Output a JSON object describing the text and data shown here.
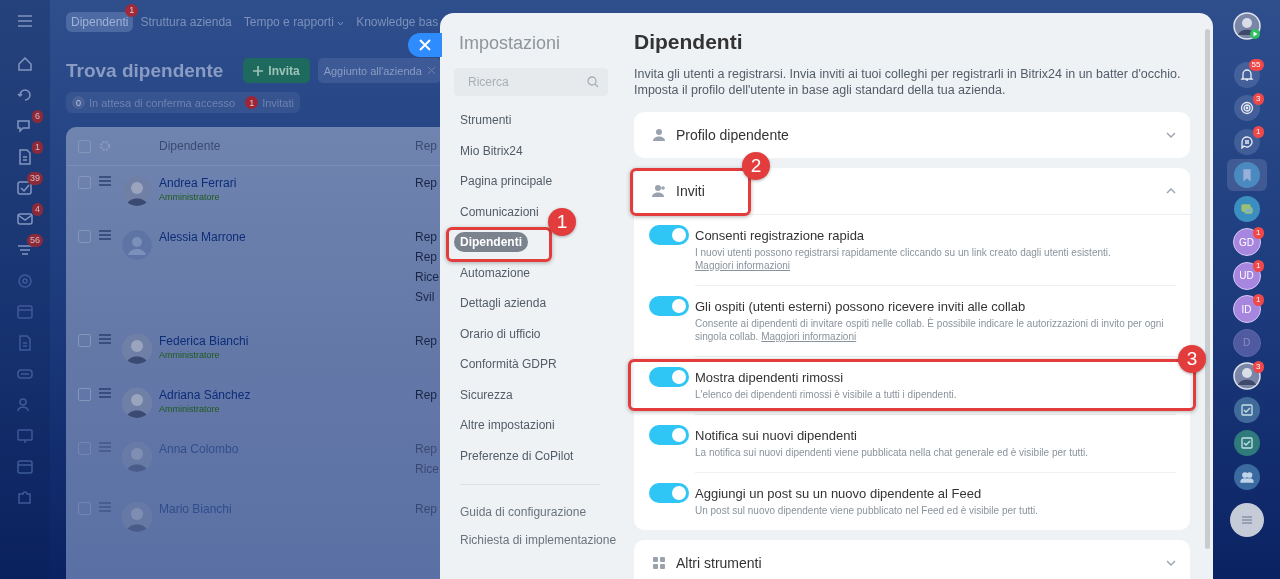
{
  "left_rail": [
    {
      "kind": "home"
    },
    {
      "kind": "refresh"
    },
    {
      "kind": "chat",
      "badge": "6"
    },
    {
      "kind": "doc",
      "badge": "1"
    },
    {
      "kind": "tasks",
      "badge": "39"
    },
    {
      "kind": "mail",
      "badge": "4"
    },
    {
      "kind": "stack",
      "badge": "56"
    },
    {
      "kind": "target"
    },
    {
      "kind": "calendar"
    },
    {
      "kind": "doc"
    },
    {
      "kind": "drive"
    },
    {
      "kind": "people"
    },
    {
      "kind": "board"
    },
    {
      "kind": "calendar"
    },
    {
      "kind": "puzzle"
    }
  ],
  "top_tabs": [
    {
      "label": "Dipendenti",
      "selected": true,
      "badge": "1"
    },
    {
      "label": "Struttura azienda",
      "selected": false
    },
    {
      "label": "Tempo e rapporti",
      "selected": false,
      "dropdown": true
    },
    {
      "label": "Knowledge bas",
      "selected": false
    }
  ],
  "page_title": "Trova dipendente",
  "invite_button": "Invita",
  "filter_chip": "Aggiunto all'azienda",
  "counters": [
    {
      "count": "0",
      "label": "In attesa di conferma accesso",
      "alert": false
    },
    {
      "count": "1",
      "label": "Invitati",
      "alert": true
    }
  ],
  "table": {
    "columns": [
      "Dipendente",
      "Rep"
    ],
    "all_checked": false,
    "rows": [
      {
        "name": "Andrea Ferrari",
        "role": "Amministratore",
        "kind": "photo",
        "checked": false,
        "column_2": [
          "Rep"
        ]
      },
      {
        "name": "Alessia Marrone",
        "kind": "placeholder",
        "checked": false,
        "column_2": [
          "Rep",
          "Rep",
          "Rice",
          "Svil"
        ]
      },
      {
        "name": "Federica Bianchi",
        "role": "Amministratore",
        "kind": "photo",
        "checked": false,
        "column_2": [
          "Rep"
        ]
      },
      {
        "name": "Adriana Sánchez",
        "role": "Amministratore",
        "kind": "photo",
        "checked": false,
        "column_2": [
          "Rep"
        ]
      },
      {
        "name": "Anna Colombo",
        "kind": "photo",
        "checked": false,
        "column_2": [
          "Rep",
          "Rice"
        ]
      },
      {
        "name": "Mario Bianchi",
        "kind": "photo",
        "checked": false,
        "column_2": [
          "Rep"
        ]
      }
    ]
  },
  "settings": {
    "title": "Impostazioni",
    "search": {
      "placeholder": "Ricerca"
    },
    "nav": [
      {
        "label": "Strumenti",
        "selected": false
      },
      {
        "label": "Mio Bitrix24",
        "selected": false
      },
      {
        "label": "Pagina principale",
        "selected": false
      },
      {
        "label": "Comunicazioni",
        "selected": false
      },
      {
        "label": "Dipendenti",
        "selected": true,
        "annotation": "1"
      },
      {
        "label": "Automazione",
        "selected": false
      },
      {
        "label": "Dettagli azienda",
        "selected": false
      },
      {
        "label": "Orario di ufficio",
        "selected": false
      },
      {
        "label": "Conformità GDPR",
        "selected": false
      },
      {
        "label": "Sicurezza",
        "selected": false
      },
      {
        "label": "Altre impostazioni",
        "selected": false
      },
      {
        "label": "Preferenze di CoPilot",
        "selected": false
      }
    ],
    "nav_footer": [
      "Guida di configurazione",
      "Richiesta di implementazione"
    ]
  },
  "content": {
    "title": "Dipendenti",
    "description": "Invita gli utenti a registrarsi. Invia inviti ai tuoi colleghi per registrarli in Bitrix24 in un batter d'occhio. Imposta il profilo dell'utente in base agli standard della tua azienda.",
    "sections": [
      {
        "title": "Profilo dipendente",
        "expanded": false
      },
      {
        "title": "Inviti",
        "expanded": true,
        "annotation": "2",
        "toggles": [
          {
            "title": "Consenti registrazione rapida",
            "description": "I nuovi utenti possono registrarsi rapidamente cliccando su un link creato dagli utenti esistenti.",
            "link": "Maggiori informazioni",
            "on": true
          },
          {
            "title": "Gli ospiti (utenti esterni) possono ricevere inviti alle collab",
            "description": "Consente ai dipendenti di invitare ospiti nelle collab. È possibile indicare le autorizzazioni di invito per ogni singola collab.",
            "link": "Maggiori informazioni",
            "on": true
          },
          {
            "title": "Mostra dipendenti rimossi",
            "description": "L'elenco dei dipendenti rimossi è visibile a tutti i dipendenti.",
            "on": true,
            "annotation": "3"
          },
          {
            "title": "Notifica sui nuovi dipendenti",
            "description": "La notifica sui nuovi dipendenti viene pubblicata nella chat generale ed è visibile per tutti.",
            "on": true
          },
          {
            "title": "Aggiungi un post su un nuovo dipendente al Feed",
            "description": "Un post sul nuovo dipendente viene pubblicato nel Feed ed è visibile per tutti.",
            "on": true
          }
        ]
      },
      {
        "title": "Altri strumenti",
        "expanded": false
      }
    ]
  },
  "right_bar": [
    {
      "kind": "user-photo"
    },
    {
      "kind": "bell",
      "badge": "55"
    },
    {
      "kind": "spiral",
      "badge": "3"
    },
    {
      "kind": "chat-swap",
      "badge": "1"
    },
    {
      "kind": "bookmark"
    },
    {
      "kind": "chat"
    },
    {
      "kind": "initials",
      "text": "GD",
      "badge": "1",
      "dim": false
    },
    {
      "kind": "initials",
      "text": "UD",
      "badge": "1",
      "dim": false
    },
    {
      "kind": "initials",
      "text": "ID",
      "badge": "1",
      "dim": false
    },
    {
      "kind": "initials",
      "text": "D",
      "dim": true
    },
    {
      "kind": "user-photo",
      "badge": "3"
    },
    {
      "kind": "check"
    },
    {
      "kind": "check"
    },
    {
      "kind": "people"
    },
    {
      "kind": "menu"
    }
  ]
}
